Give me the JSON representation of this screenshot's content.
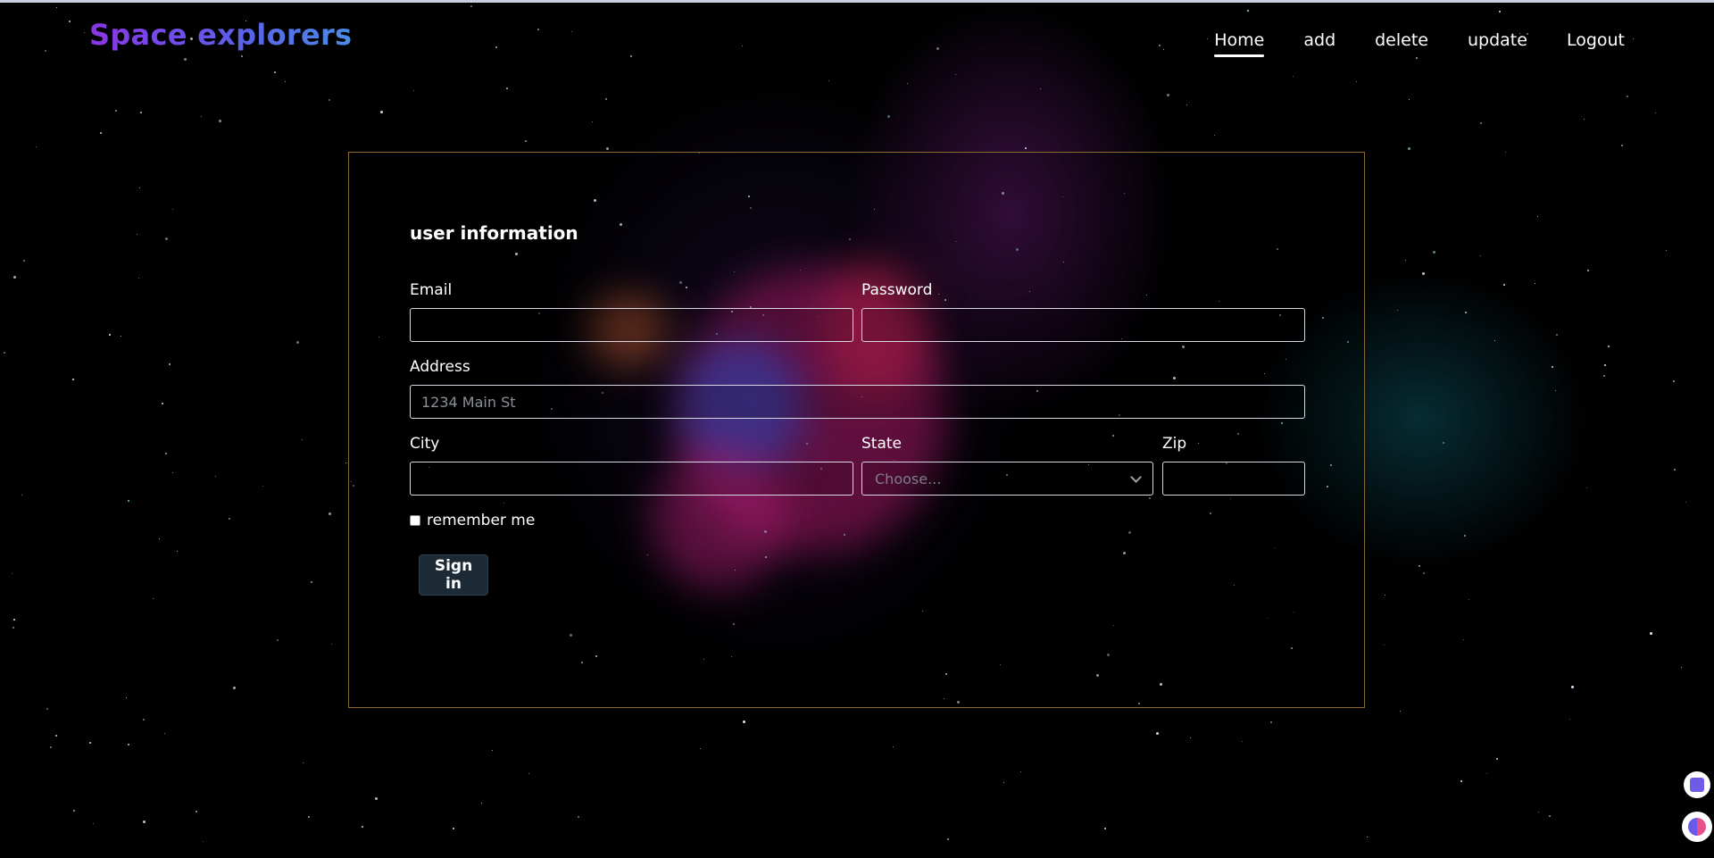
{
  "header": {
    "brand": "Space explorers",
    "nav": [
      {
        "label": "Home",
        "active": true
      },
      {
        "label": "add",
        "active": false
      },
      {
        "label": "delete",
        "active": false
      },
      {
        "label": "update",
        "active": false
      },
      {
        "label": "Logout",
        "active": false
      }
    ]
  },
  "form": {
    "title": "user information",
    "email": {
      "label": "Email",
      "value": "",
      "placeholder": ""
    },
    "password": {
      "label": "Password",
      "value": "",
      "placeholder": ""
    },
    "address": {
      "label": "Address",
      "value": "",
      "placeholder": "1234 Main St"
    },
    "city": {
      "label": "City",
      "value": "",
      "placeholder": ""
    },
    "state": {
      "label": "State",
      "selected": "Choose..."
    },
    "zip": {
      "label": "Zip",
      "value": "",
      "placeholder": ""
    },
    "remember": {
      "label": "remember me",
      "checked": false
    },
    "submit_label": "Sign in"
  },
  "colors": {
    "brand_gradient_start": "#8a35e6",
    "brand_gradient_end": "#4a8ce6",
    "card_border": "#8a6a2e",
    "button_bg": "#1c2a36"
  },
  "extension_icons": [
    "translate-icon",
    "brain-icon"
  ]
}
